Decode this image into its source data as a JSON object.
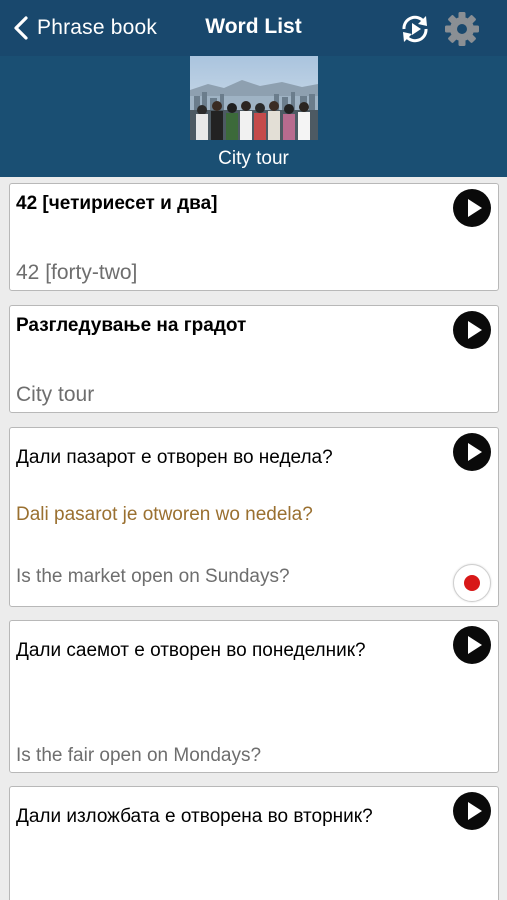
{
  "nav": {
    "back_label": "Phrase book",
    "title": "Word List"
  },
  "banner": {
    "title": "City tour"
  },
  "cards": [
    {
      "native": "42 [четириесет и два]",
      "translit": "",
      "english": "42 [forty-two]"
    },
    {
      "native": "Разгледување на градот",
      "translit": "",
      "english": "City tour"
    },
    {
      "native": "Дали пазарот е отворен во недела?",
      "translit": "Dali pasarot je otworen wo nedela?",
      "english": "Is the market open on Sundays?"
    },
    {
      "native": "Дали саемот е отворен во понеделник?",
      "translit": "",
      "english": "Is the fair open on Mondays?"
    },
    {
      "native": "Дали изложбата е отворена во вторник?",
      "translit": "",
      "english": ""
    }
  ],
  "colors": {
    "nav_background": "#19486d",
    "banner_background": "#1a4f73",
    "transliteration": "#9a7030",
    "record": "#d81818"
  },
  "icons": {
    "back": "chevron-left-icon",
    "replay": "replay-icon",
    "settings": "gear-icon",
    "play": "play-icon",
    "record": "record-icon"
  }
}
